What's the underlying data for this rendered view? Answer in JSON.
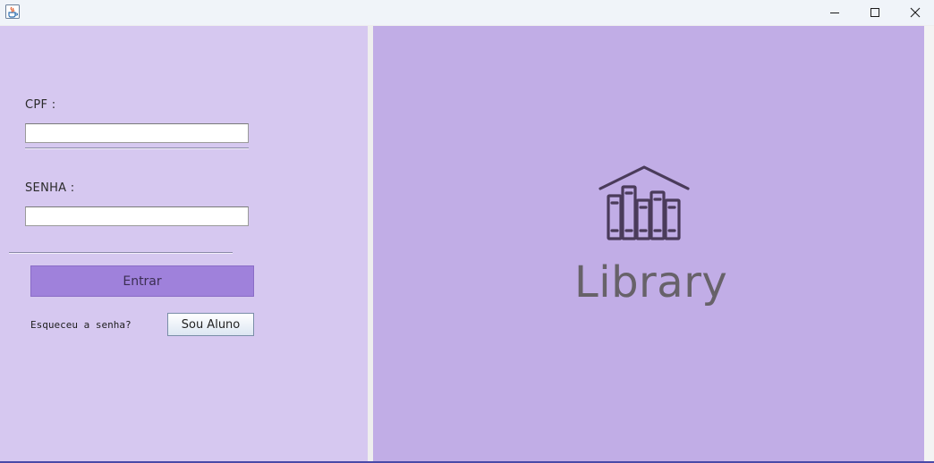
{
  "window": {
    "app_icon": "java-cup-icon",
    "controls": {
      "minimize_icon": "minimize-icon",
      "maximize_icon": "maximize-icon",
      "close_icon": "close-icon"
    }
  },
  "login": {
    "cpf_label": "CPF :",
    "cpf_value": "",
    "senha_label": "SENHA :",
    "senha_value": "",
    "enter_button": "Entrar",
    "forgot_password": "Esqueceu a senha?",
    "student_button": "Sou Aluno"
  },
  "branding": {
    "logo_icon": "library-bookshelf-icon",
    "title": "Library"
  },
  "colors": {
    "left_panel": "#d6c8f0",
    "right_panel": "#c1ade6",
    "enter_button": "#9f81db",
    "logo_text": "#676269",
    "logo_icon": "#4a3b5a"
  }
}
